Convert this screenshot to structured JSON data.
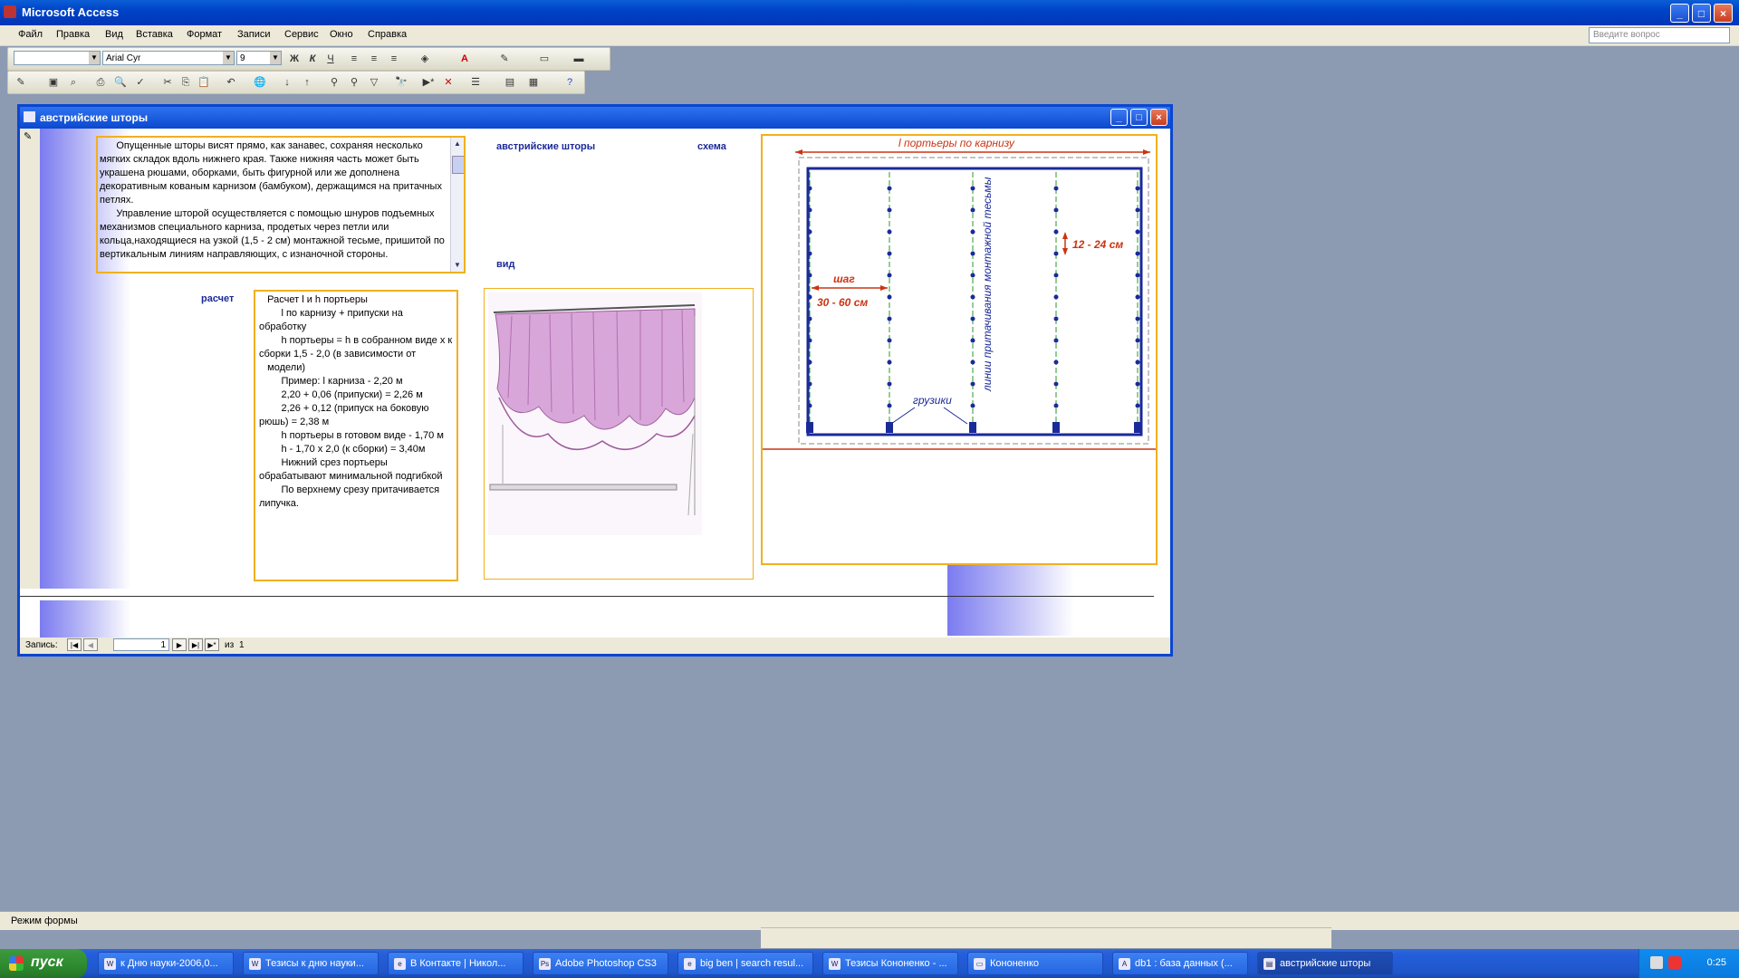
{
  "app": {
    "title": "Microsoft Access"
  },
  "menu": [
    "Файл",
    "Правка",
    "Вид",
    "Вставка",
    "Формат",
    "Записи",
    "Сервис",
    "Окно",
    "Справка"
  ],
  "ask_placeholder": "Введите вопрос",
  "toolbar": {
    "font": "Arial Cyr",
    "size": "9"
  },
  "form": {
    "title": "австрийские шторы",
    "label_title": "австрийские шторы",
    "label_scheme": "схема",
    "label_view": "вид",
    "label_calc": "расчет",
    "memo_text": "      Опущенные шторы висят прямо, как занавес, сохраняя несколько мягких складок вдоль нижнего края. Также нижняя часть может быть украшена рюшами, оборками, быть фигурной или же дополнена декоративным кованым карнизом (бамбуком), держащимся на притачных петлях.\n      Управление шторой осуществляется с помощью шнуров подъемных механизмов специального карниза, продетых через петли или кольца,находящиеся на узкой (1,5 - 2 см) монтажной тесьме, пришитой по вертикальным линиям направляющих, с изнаночной стороны.",
    "calc_text": "   Расчет l и h портьеры\n        l по карнизу + припуски на обработку\n        h портьеры = h в собранном виде х к сборки 1,5 - 2,0 (в зависимости от\n   модели)\n        Пример: l карниза - 2,20 м\n        2,20 + 0,06 (припуски) = 2,26 м\n        2,26 + 0,12 (припуск на боковую рюшь) = 2,38 м\n        h портьеры в готовом виде - 1,70 м\n        h - 1,70 х 2,0 (к сборки) = 3,40м\n        Нижний срез портьеры обрабатывают минимальной подгибкой\n        По верхнему срезу притачивается липучка.",
    "scheme": {
      "top_label": "l  портьеры по карнизу",
      "step_label": "шаг",
      "step_range": "30 - 60 см",
      "vert_range": "12 - 24 см",
      "weights_label": "грузики",
      "lines_label": "линии притачивания монтажной тесьмы"
    },
    "nav": {
      "label": "Запись:",
      "current": "1",
      "of_label": "из",
      "total": "1"
    }
  },
  "status": "Режим формы",
  "taskbar": {
    "start": "пуск",
    "tasks": [
      "к Дню науки-2006,0...",
      "Тезисы к дню науки...",
      "В Контакте | Никол...",
      "Adobe Photoshop CS3",
      "big ben | search resul...",
      "Тезисы Кононенко - ...",
      "Кононенко",
      "db1 : база данных (...",
      "австрийские шторы"
    ],
    "clock": "0:25"
  },
  "colors": {
    "accent_blue": "#1a2a9a",
    "scheme_red": "#cc3311",
    "frame_orange": "#f0b020"
  }
}
